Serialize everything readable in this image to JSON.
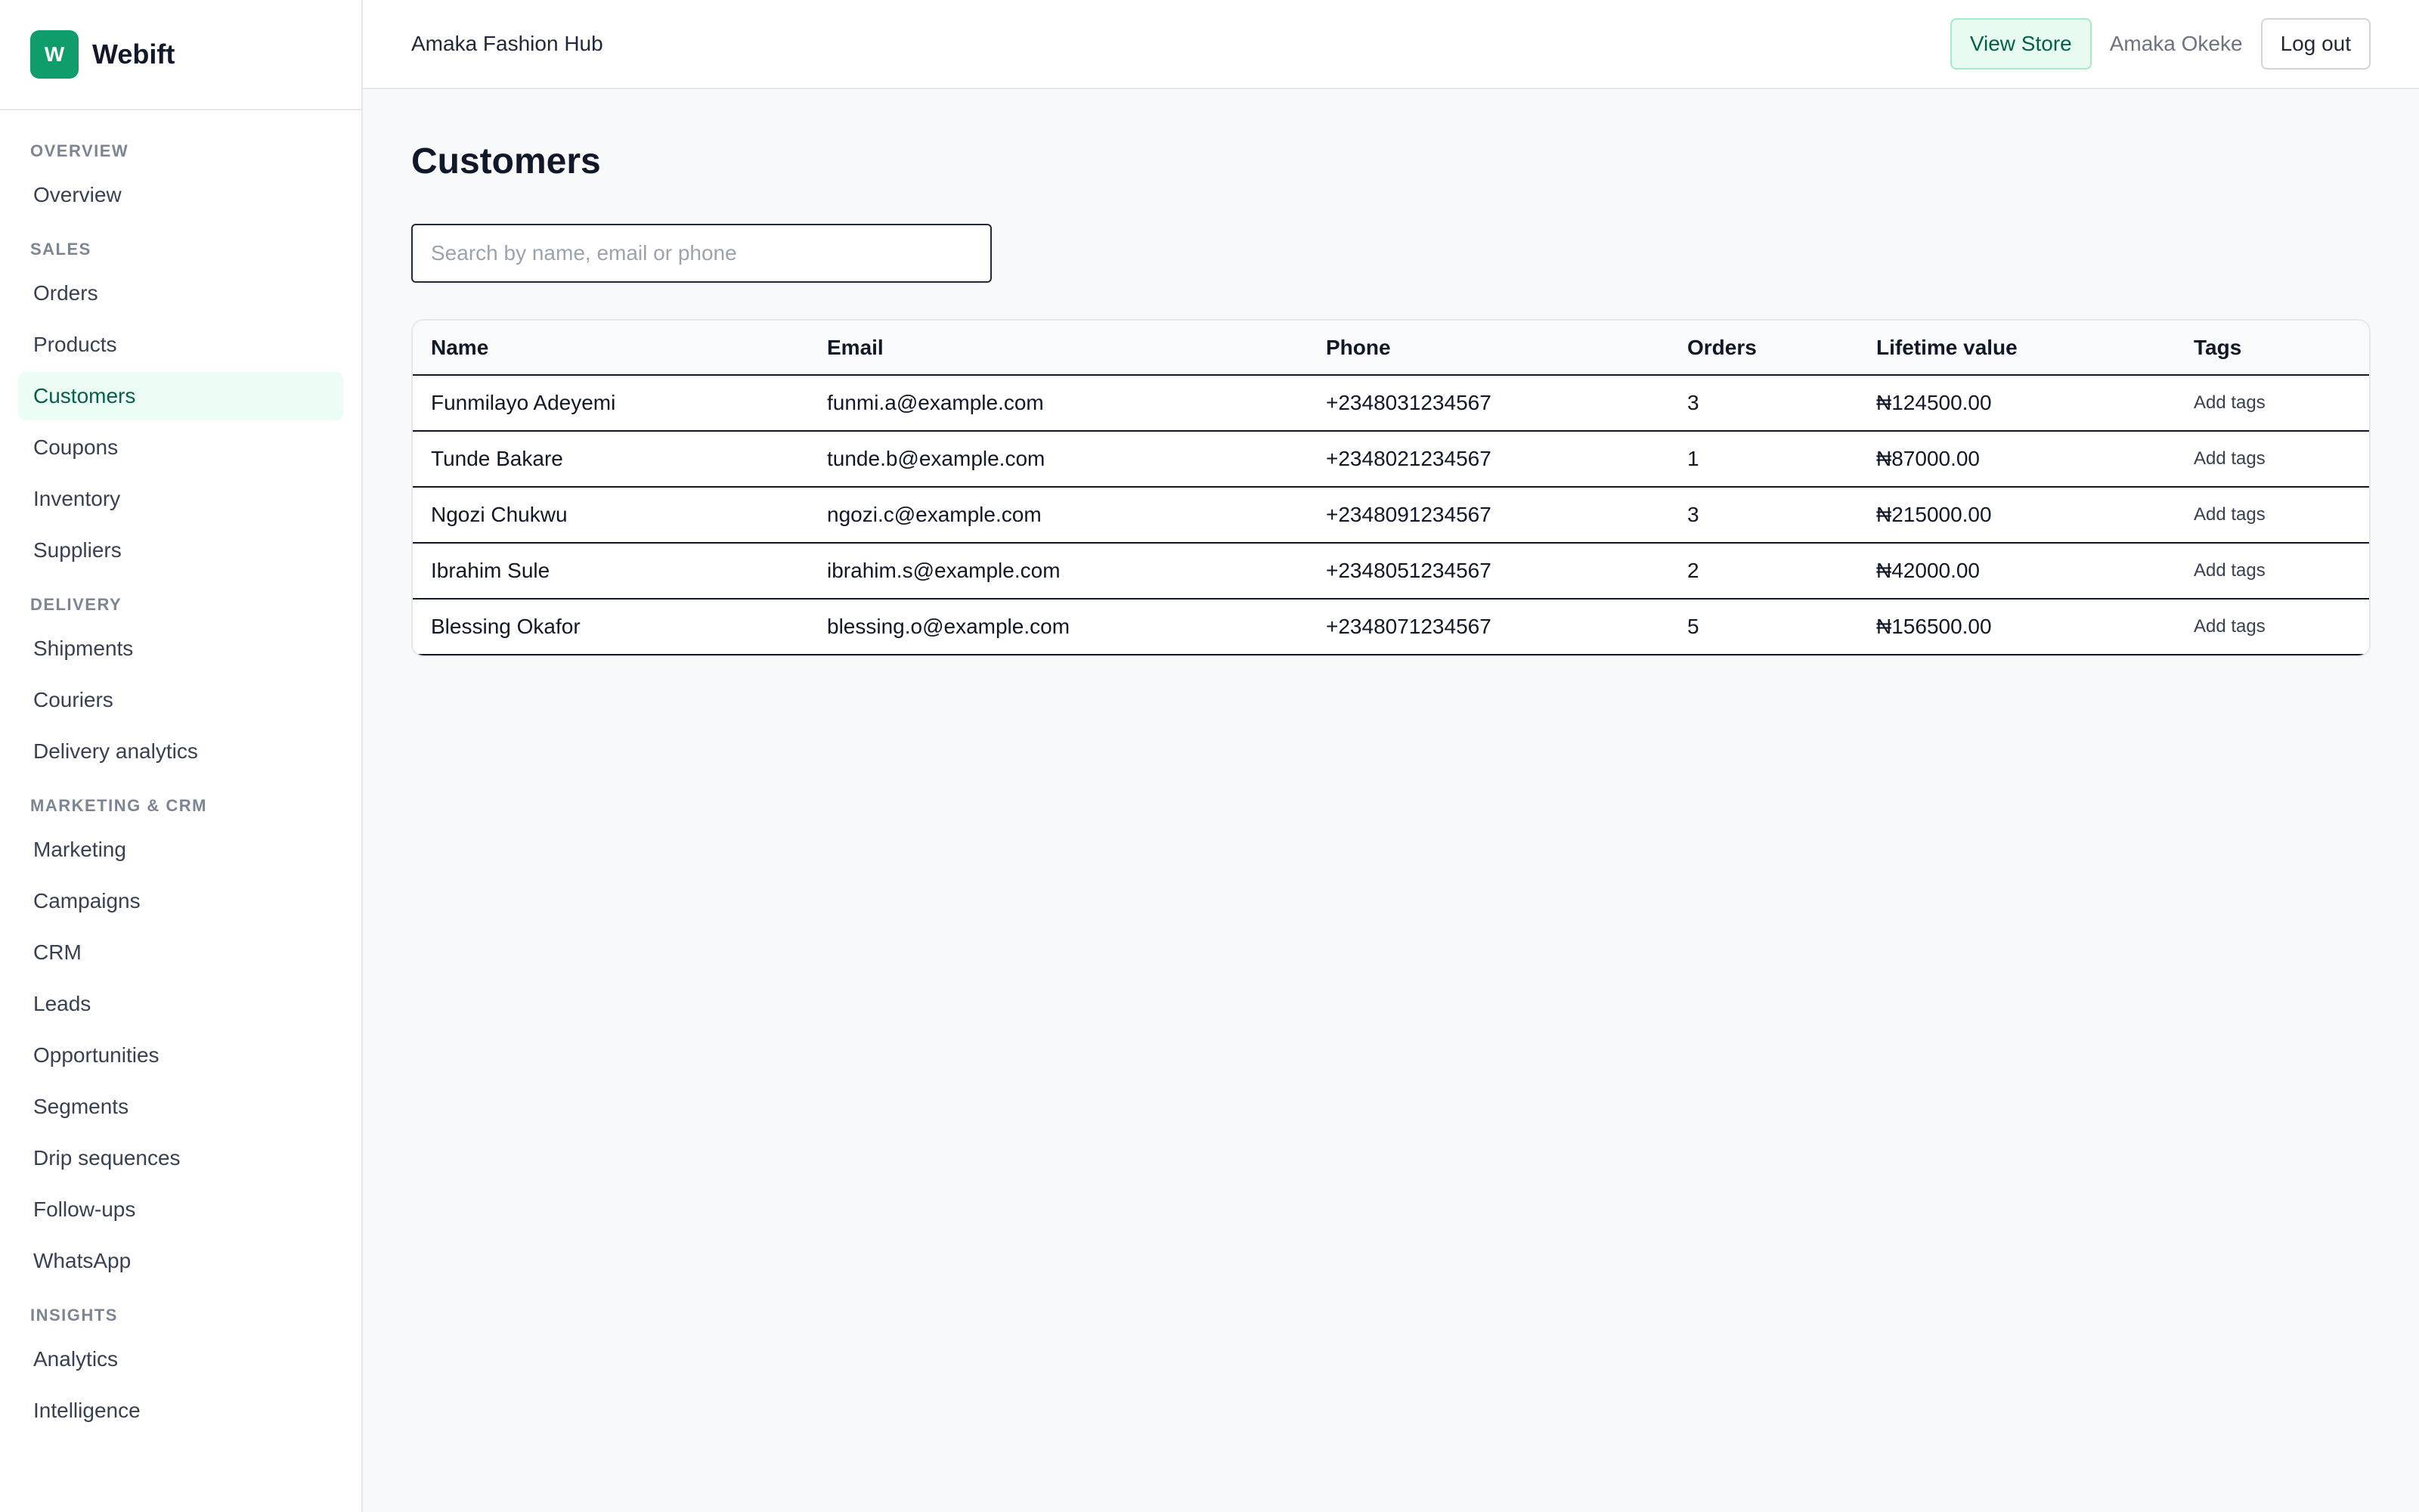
{
  "brand": {
    "logo_letter": "W",
    "name": "Webift",
    "accent": "#0f9d6b"
  },
  "sidebar": {
    "sections": [
      {
        "title": "OVERVIEW",
        "items": [
          "Overview"
        ]
      },
      {
        "title": "SALES",
        "items": [
          "Orders",
          "Products",
          "Customers",
          "Coupons",
          "Inventory",
          "Suppliers"
        ]
      },
      {
        "title": "DELIVERY",
        "items": [
          "Shipments",
          "Couriers",
          "Delivery analytics"
        ]
      },
      {
        "title": "MARKETING & CRM",
        "items": [
          "Marketing",
          "Campaigns",
          "CRM",
          "Leads",
          "Opportunities",
          "Segments",
          "Drip sequences",
          "Follow-ups",
          "WhatsApp"
        ]
      },
      {
        "title": "INSIGHTS",
        "items": [
          "Analytics",
          "Intelligence"
        ]
      }
    ],
    "active": "Customers"
  },
  "header": {
    "store_name": "Amaka Fashion Hub",
    "view_store_label": "View Store",
    "user_name": "Amaka Okeke",
    "logout_label": "Log out"
  },
  "main": {
    "title": "Customers",
    "search": {
      "placeholder": "Search by name, email or phone",
      "value": ""
    },
    "table": {
      "columns": [
        "Name",
        "Email",
        "Phone",
        "Orders",
        "Lifetime value",
        "Tags"
      ],
      "rows": [
        {
          "name": "Funmilayo Adeyemi",
          "email": "funmi.a@example.com",
          "phone": "+2348031234567",
          "orders": "3",
          "ltv": "₦124500.00",
          "tags": "Add tags"
        },
        {
          "name": "Tunde Bakare",
          "email": "tunde.b@example.com",
          "phone": "+2348021234567",
          "orders": "1",
          "ltv": "₦87000.00",
          "tags": "Add tags"
        },
        {
          "name": "Ngozi Chukwu",
          "email": "ngozi.c@example.com",
          "phone": "+2348091234567",
          "orders": "3",
          "ltv": "₦215000.00",
          "tags": "Add tags"
        },
        {
          "name": "Ibrahim Sule",
          "email": "ibrahim.s@example.com",
          "phone": "+2348051234567",
          "orders": "2",
          "ltv": "₦42000.00",
          "tags": "Add tags"
        },
        {
          "name": "Blessing Okafor",
          "email": "blessing.o@example.com",
          "phone": "+2348071234567",
          "orders": "5",
          "ltv": "₦156500.00",
          "tags": "Add tags"
        }
      ]
    }
  }
}
